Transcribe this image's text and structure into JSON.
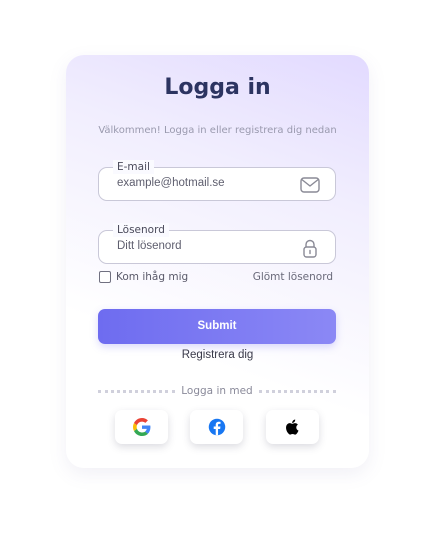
{
  "login": {
    "title": "Logga in",
    "subtitle": "Välkommen! Logga in eller registrera dig nedan",
    "email": {
      "label": "E-mail",
      "placeholder": "example@hotmail.se",
      "icon": "mail-icon"
    },
    "password": {
      "label": "Lösenord",
      "placeholder": "Ditt lösenord",
      "icon": "lock-icon"
    },
    "remember_label": "Kom ihåg mig",
    "remember_checked": false,
    "forgot_label": "Glömt lösenord",
    "submit_label": "Submit",
    "register_label": "Registrera dig",
    "divider_label": "Logga in med",
    "social": [
      {
        "icon": "google-icon"
      },
      {
        "icon": "facebook-icon"
      },
      {
        "icon": "apple-icon"
      }
    ]
  },
  "colors": {
    "title": "#2c3461",
    "submit_start": "#6e6cf0",
    "submit_end": "#8b88f5",
    "facebook": "#1877f2"
  }
}
